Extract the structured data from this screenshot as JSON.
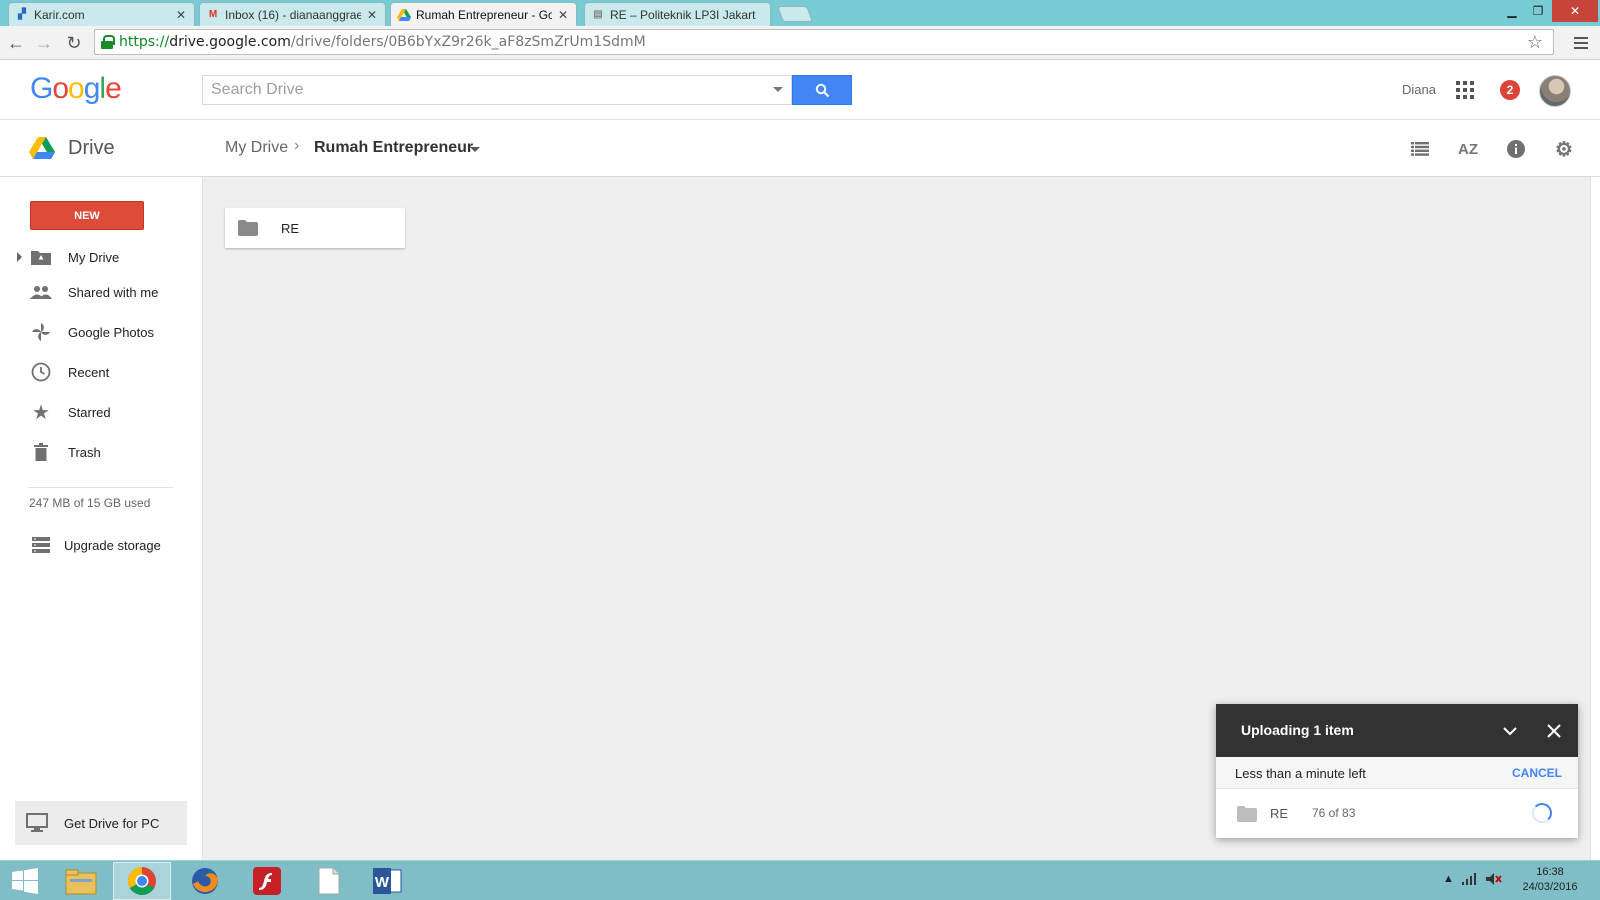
{
  "browser": {
    "tabs": [
      {
        "title": "Karir.com",
        "icon": "karir-favicon"
      },
      {
        "title": "Inbox (16) - dianaanggrae",
        "icon": "gmail-favicon"
      },
      {
        "title": "Rumah Entrepreneur - Go",
        "icon": "drive-favicon",
        "active": true
      },
      {
        "title": "RE – Politeknik LP3I Jakart",
        "icon": "site-favicon"
      }
    ],
    "url": {
      "scheme": "https://",
      "host": "drive.google.com",
      "path": "/drive/folders/0B6bYxZ9r26k_aF8zSmZrUm1SdmM"
    }
  },
  "header": {
    "logo": "Google",
    "search_placeholder": "Search Drive",
    "username": "Diana",
    "notifications": "2"
  },
  "subheader": {
    "app_name": "Drive",
    "breadcrumb": [
      "My Drive",
      "Rumah Entrepreneur"
    ]
  },
  "sidebar": {
    "new_label": "NEW",
    "items": [
      {
        "label": "My Drive",
        "icon": "my-drive-icon"
      },
      {
        "label": "Shared with me",
        "icon": "people-icon"
      },
      {
        "label": "Google Photos",
        "icon": "photos-pinwheel-icon"
      },
      {
        "label": "Recent",
        "icon": "clock-icon"
      },
      {
        "label": "Starred",
        "icon": "star-icon"
      },
      {
        "label": "Trash",
        "icon": "trash-icon"
      }
    ],
    "storage": "247 MB of 15 GB used",
    "upgrade": "Upgrade storage",
    "get_drive": "Get Drive for PC"
  },
  "main": {
    "folders": [
      {
        "name": "RE"
      }
    ]
  },
  "upload": {
    "title": "Uploading 1 item",
    "status": "Less than a minute left",
    "cancel": "CANCEL",
    "item_name": "RE",
    "progress": "76 of 83"
  },
  "taskbar": {
    "time": "16:38",
    "date": "24/03/2016"
  },
  "colors": {
    "new_button": "#dd4b39",
    "search_button": "#4285f4",
    "upload_header": "#323232",
    "notification": "#db4437"
  }
}
